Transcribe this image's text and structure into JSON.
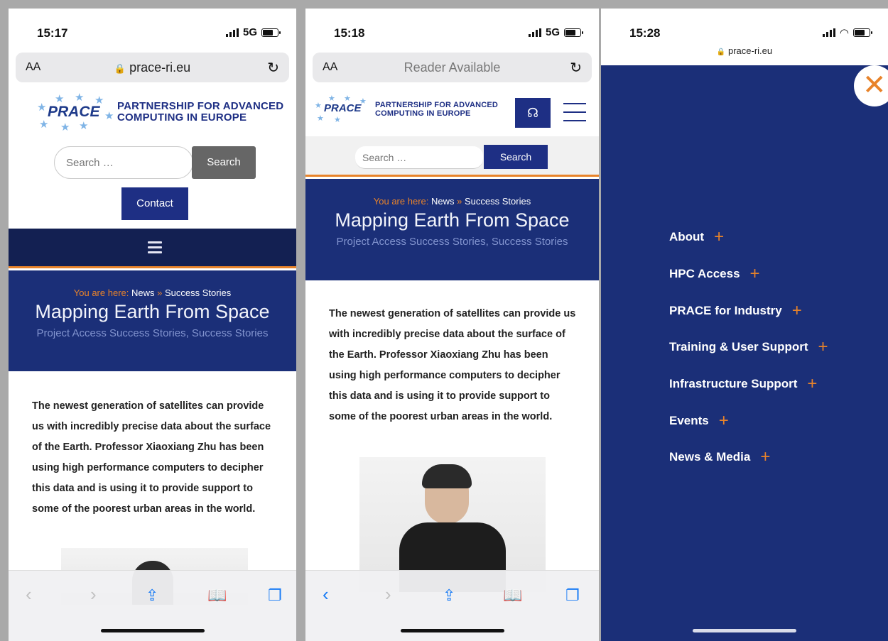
{
  "screen1": {
    "time": "15:17",
    "network": "5G",
    "url_aa": "AA",
    "url": "prace-ri.eu",
    "logo_text": "PRACE",
    "logo_name_1": "PARTNERSHIP FOR ADVANCED",
    "logo_name_2": "COMPUTING IN EUROPE",
    "search_placeholder": "Search …",
    "search_button": "Search",
    "contact_button": "Contact",
    "breadcrumb_here": "You are here:",
    "breadcrumb_news": "News",
    "breadcrumb_sep": "»",
    "breadcrumb_current": "Success Stories",
    "title": "Mapping Earth From Space",
    "categories": "Project Access Success Stories, Success Stories",
    "article": "The newest generation of satellites can provide us with incredibly precise data about the surface of the Earth. Professor Xiaoxiang Zhu has been using high performance computers to decipher this data and is using it to provide support to some of the poorest urban areas in the world."
  },
  "screen2": {
    "time": "15:18",
    "network": "5G",
    "url_aa": "AA",
    "url": "Reader Available",
    "logo_text": "PRACE",
    "logo_name_1": "PARTNERSHIP FOR ADVANCED",
    "logo_name_2": "COMPUTING IN EUROPE",
    "search_placeholder": "Search …",
    "search_button": "Search",
    "breadcrumb_here": "You are here:",
    "breadcrumb_news": "News",
    "breadcrumb_sep": "»",
    "breadcrumb_current": "Success Stories",
    "title": "Mapping Earth From Space",
    "categories": "Project Access Success Stories, Success Stories",
    "article": "The newest generation of satellites can provide us with incredibly precise data about the surface of the Earth. Professor Xiaoxiang Zhu has been using high performance computers to decipher this data and is using it to provide support to some of the poorest urban areas in the world."
  },
  "screen3": {
    "time": "15:28",
    "url": "prace-ri.eu",
    "menu": [
      {
        "label": "About"
      },
      {
        "label": "HPC Access"
      },
      {
        "label": "PRACE for Industry"
      },
      {
        "label": "Training & User Support"
      },
      {
        "label": "Infrastructure Support"
      },
      {
        "label": "Events"
      },
      {
        "label": "News & Media"
      }
    ]
  },
  "colors": {
    "brand_blue": "#1e2f84",
    "hero_blue": "#1b2f78",
    "accent_orange": "#e8832a",
    "ios_blue": "#1a7cf5"
  },
  "icons": {
    "back": "chevron-left-icon",
    "forward": "chevron-right-icon",
    "share": "share-icon",
    "bookmarks": "book-icon",
    "tabs": "tabs-icon",
    "reload": "reload-icon",
    "lock": "lock-icon",
    "hamburger": "hamburger-icon",
    "headset": "headset-icon",
    "close": "close-icon",
    "plus": "plus-icon"
  }
}
